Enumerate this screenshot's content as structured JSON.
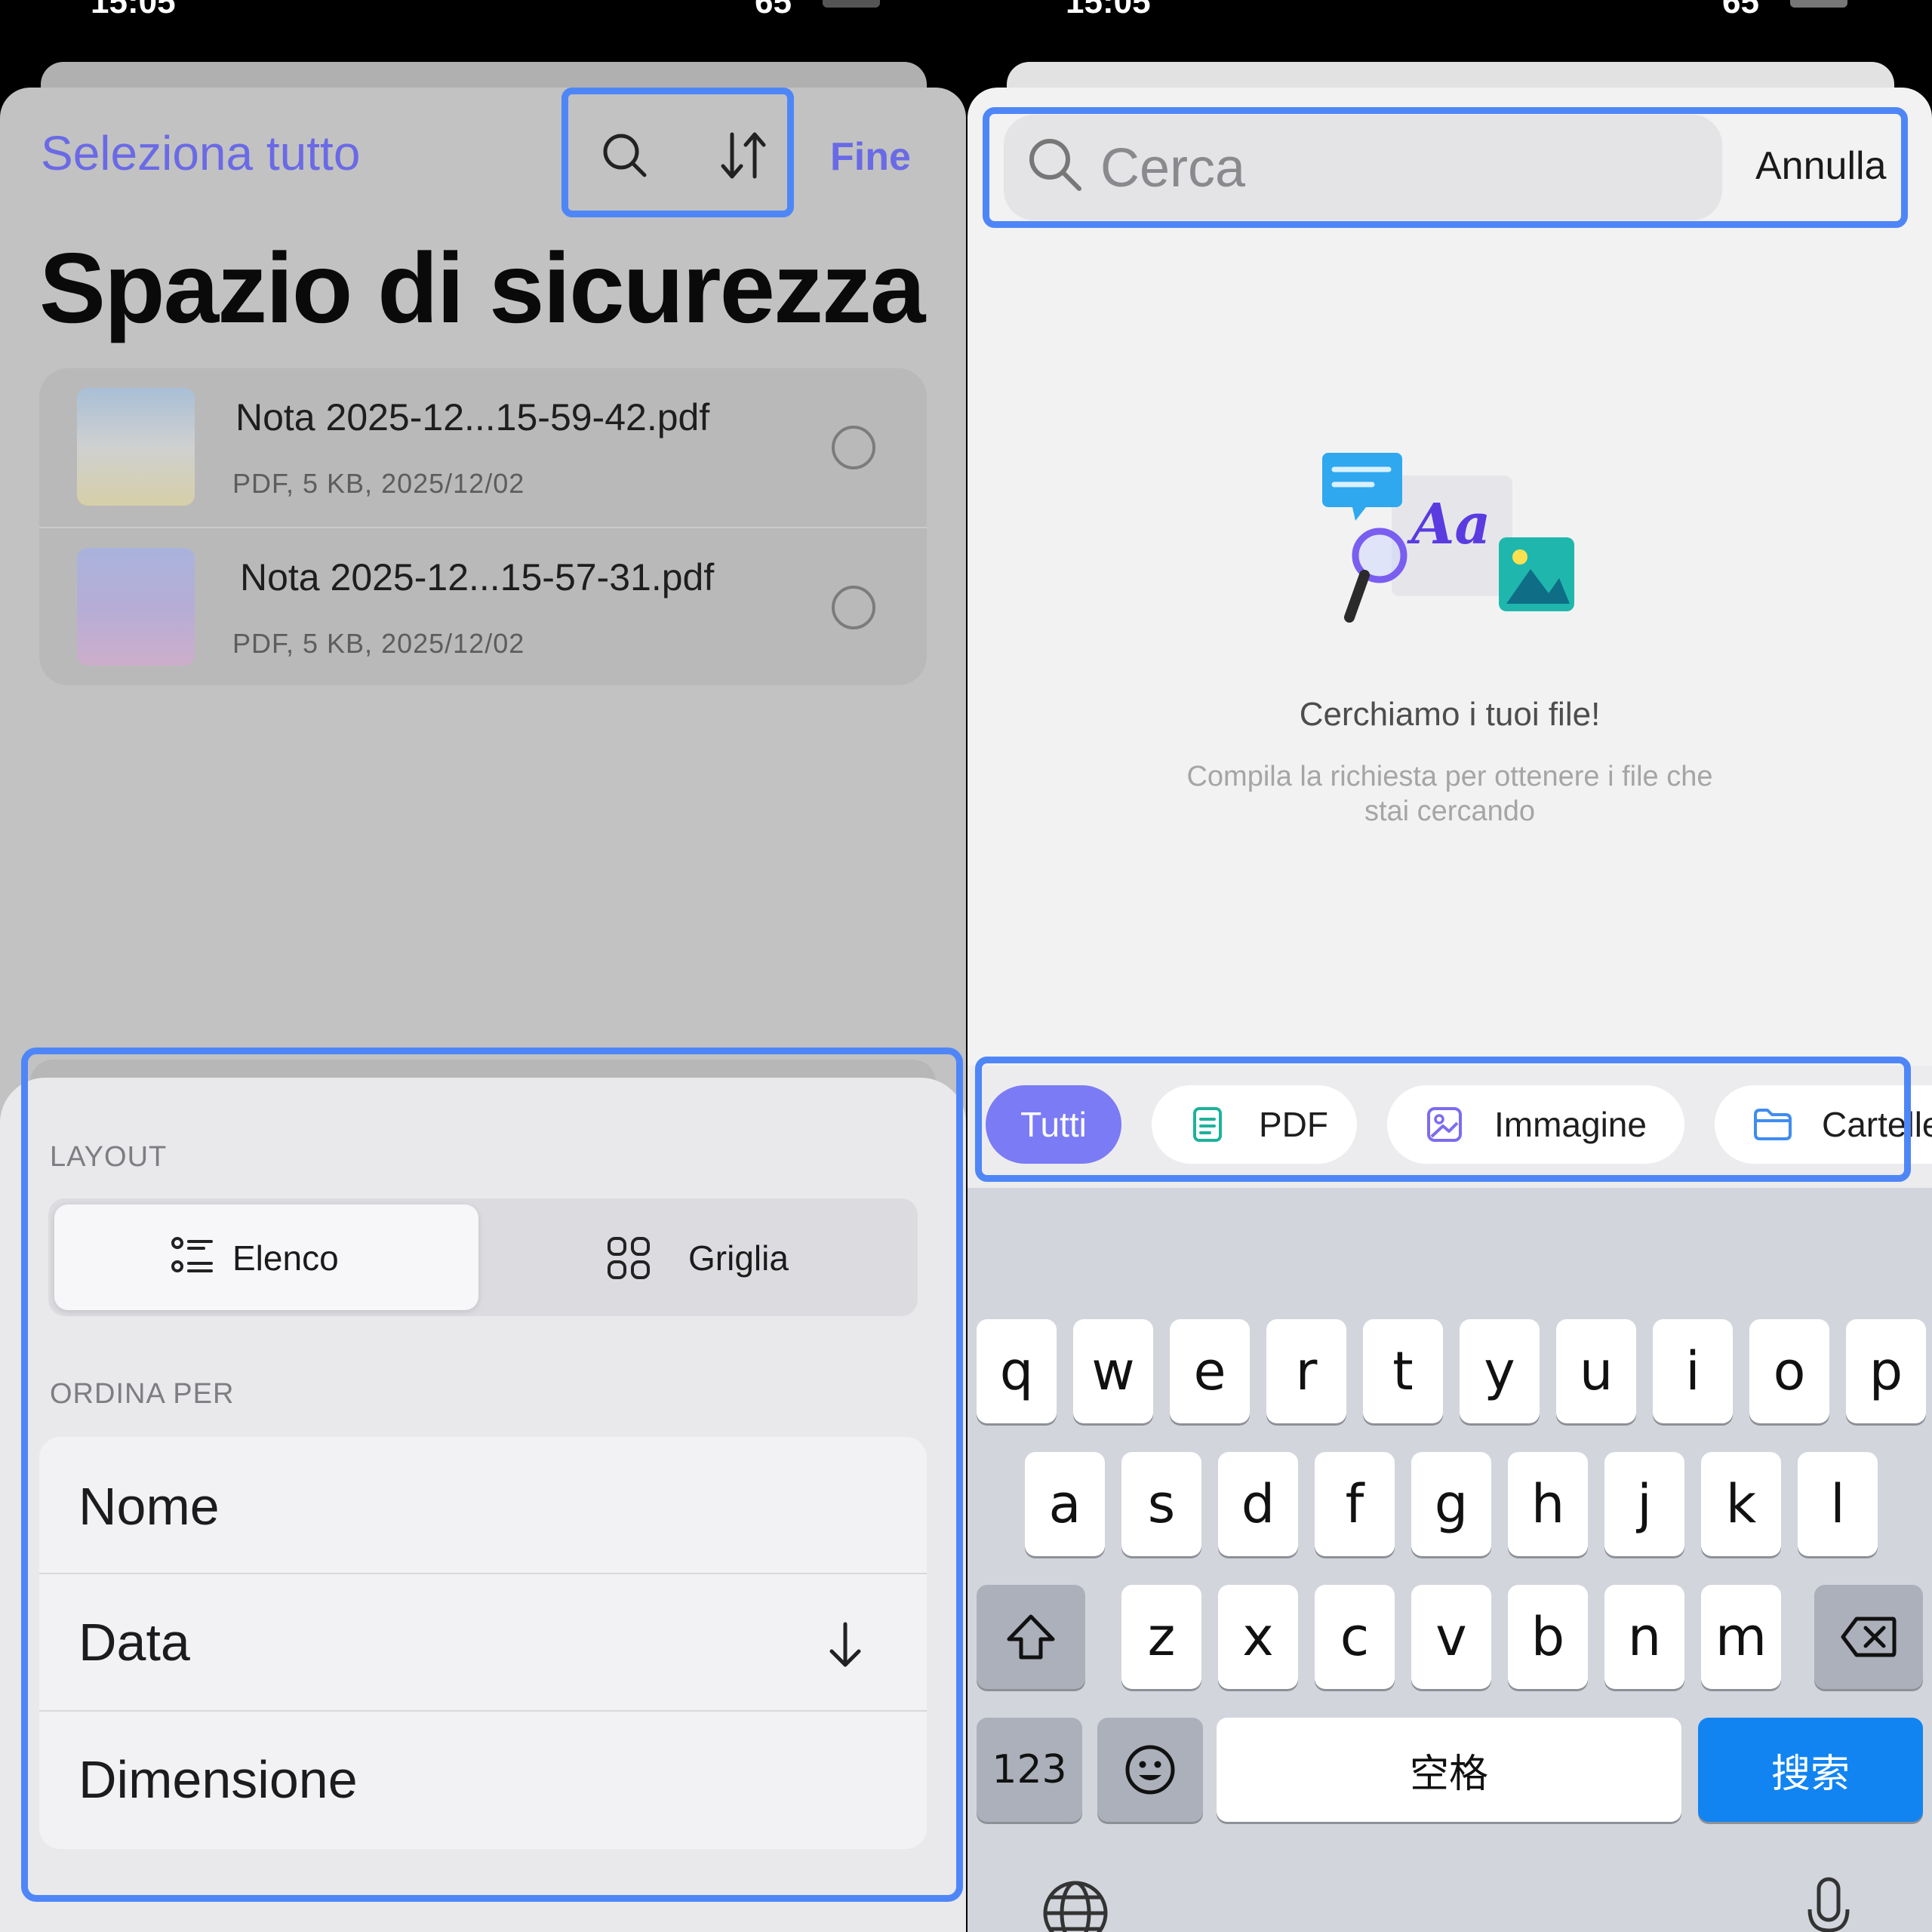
{
  "left": {
    "status": {
      "time": "15:05",
      "battery": "65"
    },
    "header": {
      "select_all": "Seleziona tutto",
      "done": "Fine"
    },
    "page_title": "Spazio di sicurezza",
    "files": [
      {
        "name": "Nota 2025-12...15-59-42.pdf",
        "meta": "PDF, 5 KB, 2025/12/02"
      },
      {
        "name": "Nota 2025-12...15-57-31.pdf",
        "meta": "PDF, 5 KB, 2025/12/02"
      }
    ],
    "sort_sheet": {
      "layout_label": "LAYOUT",
      "layout_options": [
        "Elenco",
        "Griglia"
      ],
      "selected_layout": "Elenco",
      "sort_label": "ORDINA PER",
      "sort_options": [
        "Nome",
        "Data",
        "Dimensione"
      ],
      "selected_sort": "Data",
      "sort_direction": "descending"
    }
  },
  "right": {
    "status": {
      "time": "15:05",
      "battery": "65"
    },
    "search": {
      "placeholder": "Cerca",
      "cancel": "Annulla"
    },
    "empty_state": {
      "title": "Cerchiamo i tuoi file!",
      "subtitle_line1": "Compila la richiesta per ottenere i file che",
      "subtitle_line2": "stai cercando"
    },
    "filters": [
      "Tutti",
      "PDF",
      "Immagine",
      "Cartelle"
    ],
    "selected_filter": "Tutti",
    "keyboard": {
      "row1": [
        "q",
        "w",
        "e",
        "r",
        "t",
        "y",
        "u",
        "i",
        "o",
        "p"
      ],
      "row2": [
        "a",
        "s",
        "d",
        "f",
        "g",
        "h",
        "j",
        "k",
        "l"
      ],
      "row3": [
        "z",
        "x",
        "c",
        "v",
        "b",
        "n",
        "m"
      ],
      "numbers": "123",
      "space": "空格",
      "search": "搜索"
    }
  },
  "colors": {
    "accent": "#6a6ae6",
    "highlight": "#4f86f7",
    "chip_active": "#7b7bf5",
    "key_blue": "#1184f2"
  }
}
